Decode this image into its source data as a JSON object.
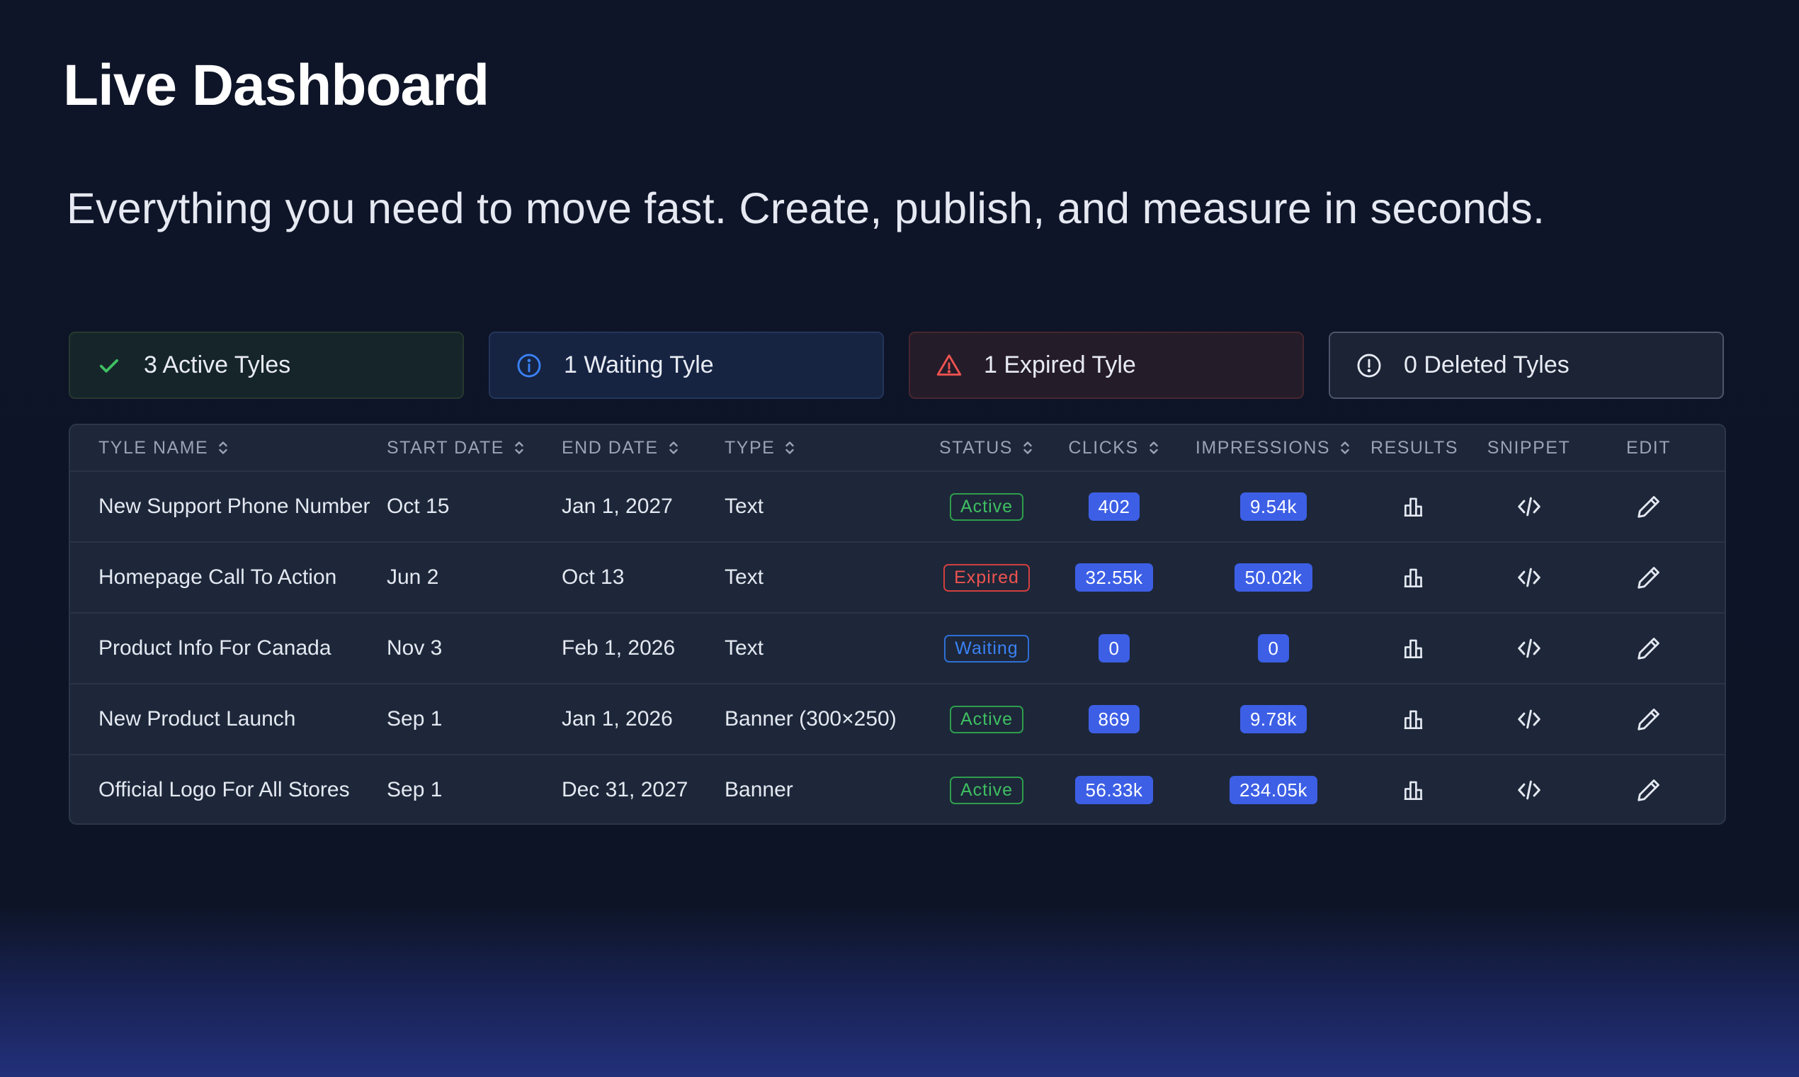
{
  "header": {
    "title": "Live Dashboard",
    "subtitle": "Everything you need to move fast. Create, publish, and measure in seconds."
  },
  "stats": {
    "active": {
      "label": "3 Active Tyles",
      "icon": "check-icon",
      "color": "#3fbf62"
    },
    "waiting": {
      "label": "1 Waiting Tyle",
      "icon": "info-icon",
      "color": "#3b82f6"
    },
    "expired": {
      "label": "1 Expired Tyle",
      "icon": "warning-triangle-icon",
      "color": "#ef5350"
    },
    "deleted": {
      "label": "0 Deleted Tyles",
      "icon": "exclamation-circle-icon",
      "color": "#e8ebf3"
    }
  },
  "table": {
    "columns": {
      "name": "TYLE NAME",
      "start": "START DATE",
      "end": "END DATE",
      "type": "TYPE",
      "status": "STATUS",
      "clicks": "CLICKS",
      "impressions": "IMPRESSIONS",
      "results": "RESULTS",
      "snippet": "SNIPPET",
      "edit": "EDIT"
    },
    "rows": [
      {
        "name": "New Support Phone Number",
        "start": "Oct 15",
        "end": "Jan 1, 2027",
        "type": "Text",
        "status": "Active",
        "clicks": "402",
        "impressions": "9.54k"
      },
      {
        "name": "Homepage Call To Action",
        "start": "Jun 2",
        "end": "Oct 13",
        "type": "Text",
        "status": "Expired",
        "clicks": "32.55k",
        "impressions": "50.02k"
      },
      {
        "name": "Product Info For Canada",
        "start": "Nov 3",
        "end": "Feb 1, 2026",
        "type": "Text",
        "status": "Waiting",
        "clicks": "0",
        "impressions": "0"
      },
      {
        "name": "New Product Launch",
        "start": "Sep 1",
        "end": "Jan 1, 2026",
        "type": "Banner (300×250)",
        "status": "Active",
        "clicks": "869",
        "impressions": "9.78k"
      },
      {
        "name": "Official Logo For All Stores",
        "start": "Sep 1",
        "end": "Dec 31, 2027",
        "type": "Banner",
        "status": "Active",
        "clicks": "56.33k",
        "impressions": "234.05k"
      }
    ],
    "icons": {
      "results": "bar-chart-icon",
      "snippet": "code-icon",
      "edit": "pencil-icon"
    }
  },
  "colors": {
    "background": "#0e1528",
    "accent_pill": "#3d5fe6",
    "active": "#3fbf62",
    "expired": "#ef5350",
    "waiting": "#3b82f6"
  }
}
